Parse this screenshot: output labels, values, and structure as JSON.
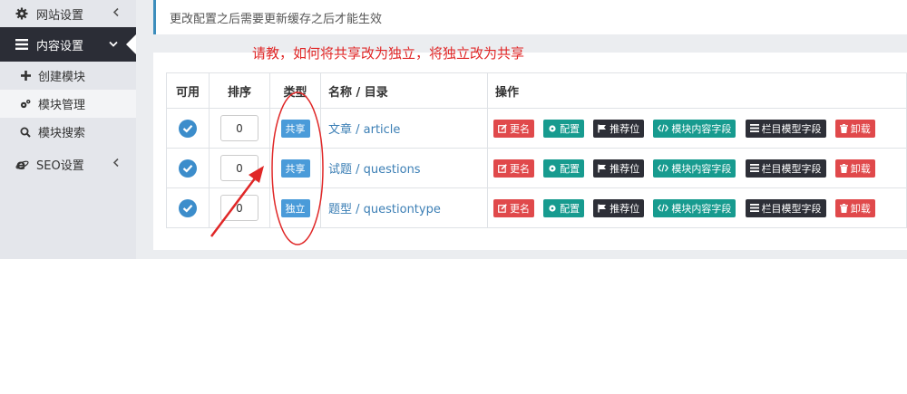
{
  "sidebar": {
    "website_settings": "网站设置",
    "content_settings": "内容设置",
    "create_module": "创建模块",
    "module_management": "模块管理",
    "module_search": "模块搜索",
    "seo_settings": "SEO设置"
  },
  "notice": "更改配置之后需要更新缓存之后才能生效",
  "annotation": "请教，如何将共享改为独立，将独立改为共享",
  "table": {
    "headers": {
      "available": "可用",
      "sort": "排序",
      "type": "类型",
      "name": "名称 / 目录",
      "operations": "操作"
    },
    "rows": [
      {
        "sort": "0",
        "type": "共享",
        "name": "文章 / article"
      },
      {
        "sort": "0",
        "type": "共享",
        "name": "试题 / questions"
      },
      {
        "sort": "0",
        "type": "独立",
        "name": "题型 / questiontype"
      }
    ],
    "actions": {
      "rename": "更名",
      "config": "配置",
      "recommend": "推荐位",
      "module_fields": "模块内容字段",
      "column_fields": "栏目模型字段",
      "uninstall": "卸载"
    }
  },
  "colors": {
    "sidebar_active": "#2b2d36",
    "accent_blue": "#3c8dcb",
    "annotation_red": "#e02727",
    "btn_red": "#e0494b",
    "btn_teal": "#179b8f",
    "btn_dark": "#2d2f37"
  },
  "icons": [
    "gear-icon",
    "list-icon",
    "plus-icon",
    "cogs-icon",
    "search-icon",
    "ie-icon",
    "chevron-left-icon",
    "chevron-down-icon",
    "check-circle-icon",
    "edit-icon",
    "flag-icon",
    "code-icon",
    "bars-icon",
    "trash-icon"
  ]
}
